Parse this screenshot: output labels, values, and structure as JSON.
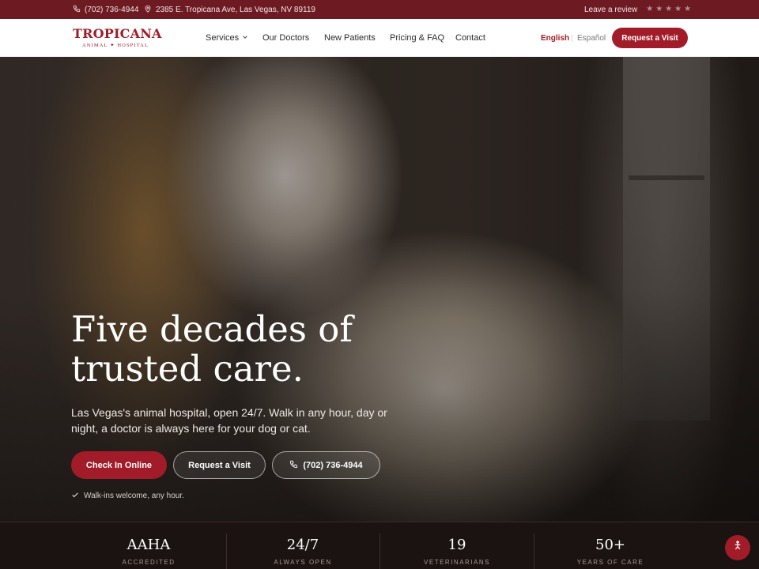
{
  "topbar": {
    "phone": "(702) 736-4944",
    "address": "2385 E. Tropicana Ave, Las Vegas, NV 89119",
    "review_label": "Leave a review",
    "stars": [
      "★",
      "★",
      "★",
      "★",
      "★"
    ]
  },
  "header": {
    "logo_name": "TROPICANA",
    "logo_sub": "ANIMAL ✦ HOSPITAL",
    "nav": {
      "services": "Services",
      "doctors": "Our Doctors",
      "new_patients": "New Patients",
      "pricing": "Pricing & FAQ",
      "contact": "Contact"
    },
    "lang_en": "English",
    "lang_sep": "|",
    "lang_es": "Español",
    "request_label": "Request a Visit"
  },
  "hero": {
    "headline_line1": "Five decades of",
    "headline_line2": "trusted care.",
    "subtext": "Las Vegas's animal hospital, open 24/7. Walk in any hour, day or night, a doctor is always here for your dog or cat.",
    "cta_check_in": "Check In Online",
    "cta_request": "Request a Visit",
    "cta_phone": "(702) 736-4944",
    "walkin_note": "Walk-ins welcome, any hour."
  },
  "stats": [
    {
      "value": "AAHA",
      "label": "ACCREDITED"
    },
    {
      "value": "24/7",
      "label": "ALWAYS OPEN"
    },
    {
      "value": "19",
      "label": "VETERINARIANS"
    },
    {
      "value": "50+",
      "label": "YEARS OF CARE"
    }
  ],
  "colors": {
    "brand_red": "#a11c28",
    "topbar_bg": "#6e1a22",
    "stats_bg": "#1b1311"
  }
}
